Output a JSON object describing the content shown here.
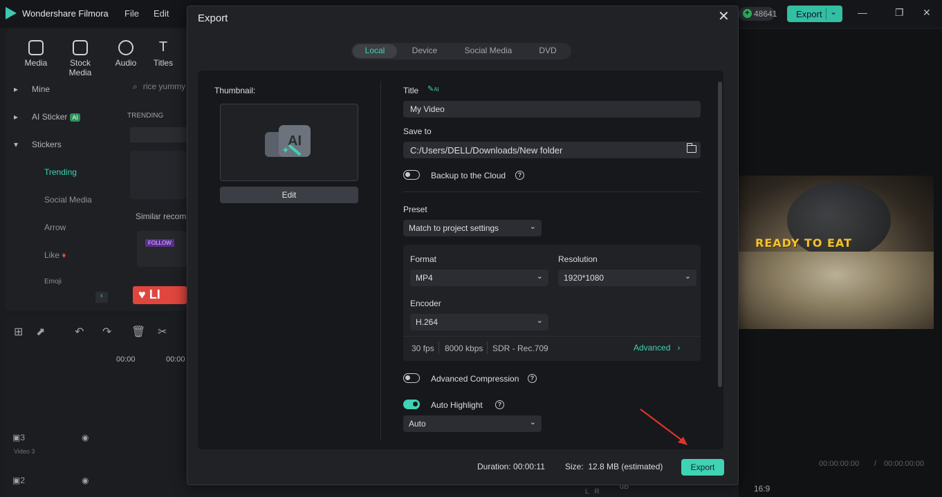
{
  "app": {
    "name": "Wondershare Filmora",
    "menus": [
      "File",
      "Edit"
    ],
    "credits": "48641",
    "export_label": "Export",
    "toolbar": [
      {
        "label": "Media",
        "icon": "media-icon"
      },
      {
        "label": "Stock Media",
        "icon": "stock-media-icon"
      },
      {
        "label": "Audio",
        "icon": "audio-icon"
      },
      {
        "label": "Titles",
        "icon": "titles-icon"
      }
    ],
    "sidebar": {
      "mine": "Mine",
      "ai_sticker": "AI Sticker",
      "ai_badge": "AI",
      "stickers": "Stickers",
      "subitems": [
        "Trending",
        "Social Media",
        "Arrow",
        "Like",
        "Emoji"
      ]
    },
    "search_placeholder": "rice yummy",
    "trending_header": "TRENDING",
    "similar": "Similar recom",
    "follow_sticker": "FOLLOW",
    "like_sticker": "LI",
    "timecodes": [
      "00:00",
      "00:00"
    ],
    "tracks": [
      {
        "number": "3",
        "name": "Video 3"
      },
      {
        "number": "2",
        "name": ""
      }
    ],
    "preview_text": "READY TO EAT",
    "preview_times": [
      "00:00:00:00",
      "/",
      "00:00:00:00"
    ],
    "aspect_ratio": "16:9",
    "db_label": "dB",
    "lr_label": "L   R"
  },
  "modal": {
    "title": "Export",
    "tabs": [
      {
        "label": "Local",
        "active": true
      },
      {
        "label": "Device",
        "active": false
      },
      {
        "label": "Social Media",
        "active": false
      },
      {
        "label": "DVD",
        "active": false
      }
    ],
    "thumbnail_label": "Thumbnail:",
    "edit_label": "Edit",
    "title_label": "Title",
    "ai_icon_text": "AI",
    "title_value": "My Video",
    "save_to_label": "Save to",
    "save_to_value": "C:/Users/DELL/Downloads/New folder",
    "backup_label": "Backup to the Cloud",
    "backup_on": false,
    "preset_label": "Preset",
    "preset_value": "Match to project settings",
    "format_label": "Format",
    "format_value": "MP4",
    "resolution_label": "Resolution",
    "resolution_value": "1920*1080",
    "encoder_label": "Encoder",
    "encoder_value": "H.264",
    "stats": {
      "fps": "30 fps",
      "bitrate": "8000 kbps",
      "color": "SDR - Rec.709"
    },
    "advanced_label": "Advanced",
    "compression_label": "Advanced Compression",
    "compression_on": false,
    "highlight_label": "Auto Highlight",
    "highlight_on": true,
    "highlight_value": "Auto",
    "duration_label": "Duration:",
    "duration_value": "00:00:11",
    "size_label": "Size:",
    "size_value": "12.8 MB (estimated)",
    "export_label": "Export"
  },
  "colors": {
    "accent": "#3fd3b3",
    "annotation_arrow": "#e0332c"
  }
}
